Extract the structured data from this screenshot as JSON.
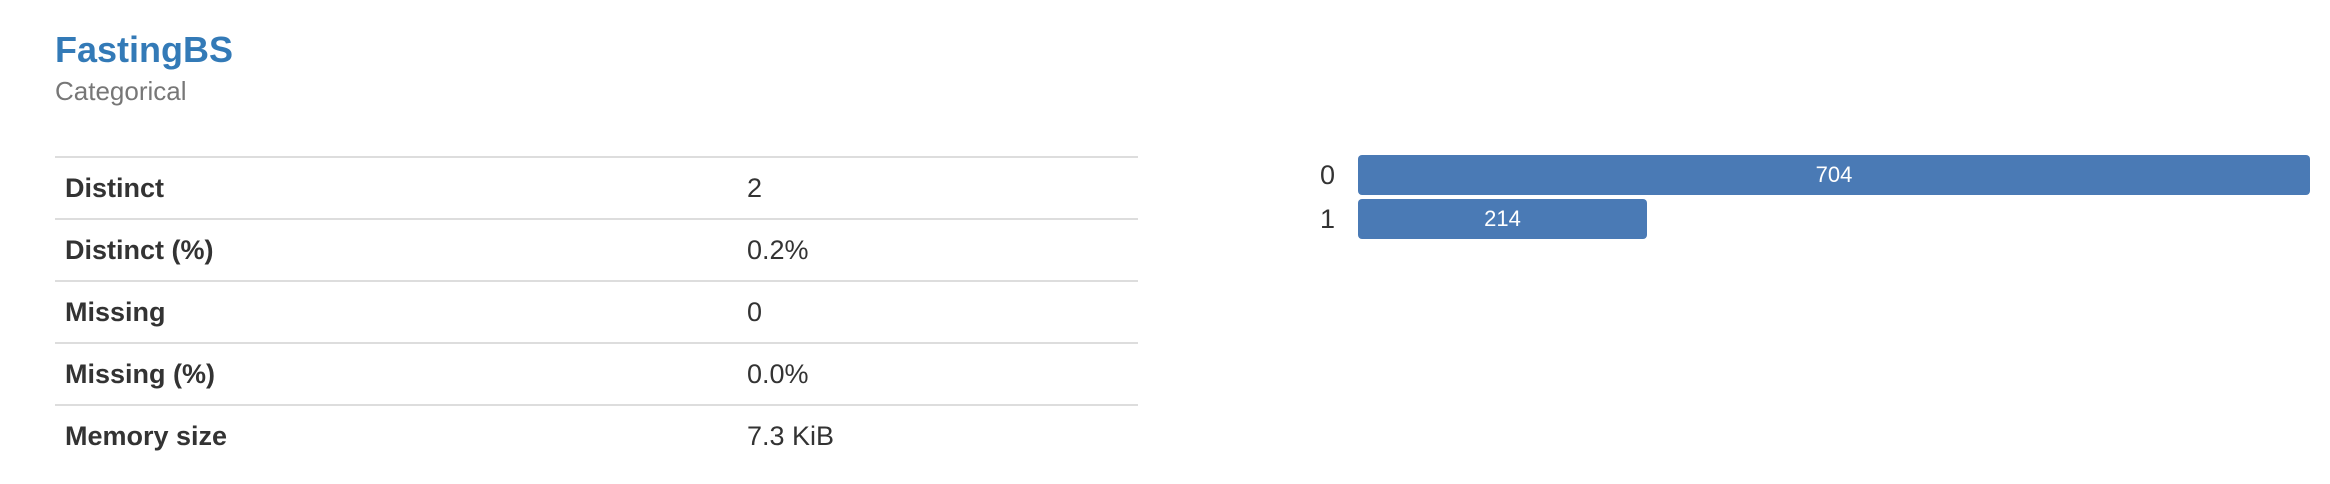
{
  "variable": {
    "name": "FastingBS",
    "type": "Categorical"
  },
  "stats": [
    {
      "label": "Distinct",
      "value": "2"
    },
    {
      "label": "Distinct (%)",
      "value": "0.2%"
    },
    {
      "label": "Missing",
      "value": "0"
    },
    {
      "label": "Missing (%)",
      "value": "0.0%"
    },
    {
      "label": "Memory size",
      "value": "7.3 KiB"
    }
  ],
  "colors": {
    "title": "#337ab7",
    "bar": "#4a7ab5"
  },
  "chart_data": {
    "type": "bar",
    "orientation": "horizontal",
    "categories": [
      "0",
      "1"
    ],
    "values": [
      704,
      214
    ]
  }
}
